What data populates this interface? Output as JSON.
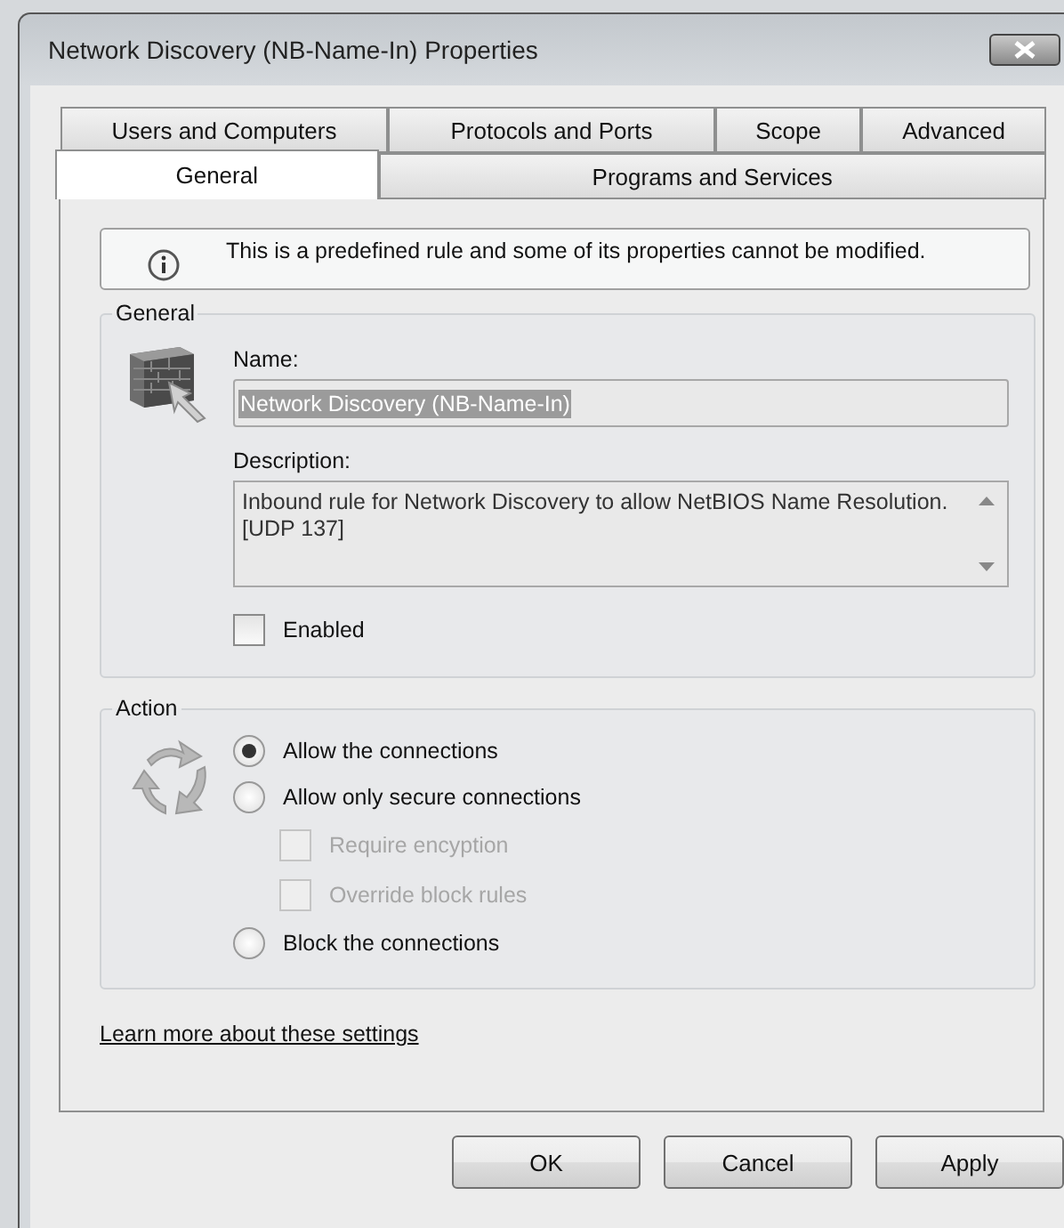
{
  "window": {
    "title": "Network Discovery (NB-Name-In) Properties"
  },
  "tab_rows": [
    {
      "tabs": [
        {
          "label": "Users and Computers",
          "selected": false
        },
        {
          "label": "Protocols and Ports",
          "selected": false
        },
        {
          "label": "Scope",
          "selected": false
        },
        {
          "label": "Advanced",
          "selected": false
        }
      ]
    },
    {
      "tabs": [
        {
          "label": "General",
          "selected": true
        },
        {
          "label": "Programs and Services",
          "selected": false
        }
      ]
    }
  ],
  "info": "This is a predefined rule and some of its properties cannot be modified.",
  "general": {
    "legend": "General",
    "name_label": "Name:",
    "name_value": {
      "text": "Network Discovery (NB-Name-In)",
      "selected": true
    },
    "description_label": "Description:",
    "description": "Inbound rule for Network Discovery to allow NetBIOS Name Resolution. [UDP 137]",
    "enabled": {
      "label": "Enabled",
      "checked": false
    }
  },
  "action": {
    "legend": "Action",
    "options": [
      {
        "kind": "radio",
        "label": "Allow the connections",
        "selected": true,
        "disabled": false
      },
      {
        "kind": "radio",
        "label": "Allow only secure connections",
        "selected": false,
        "disabled": false
      },
      {
        "kind": "checkbox",
        "label": "Require encyption",
        "checked": false,
        "disabled": true
      },
      {
        "kind": "checkbox",
        "label": "Override block rules",
        "checked": false,
        "disabled": true
      },
      {
        "kind": "radio",
        "label": "Block the connections",
        "selected": false,
        "disabled": false
      }
    ]
  },
  "link": "Learn more about these settings",
  "buttons": [
    "OK",
    "Cancel",
    "Apply"
  ]
}
